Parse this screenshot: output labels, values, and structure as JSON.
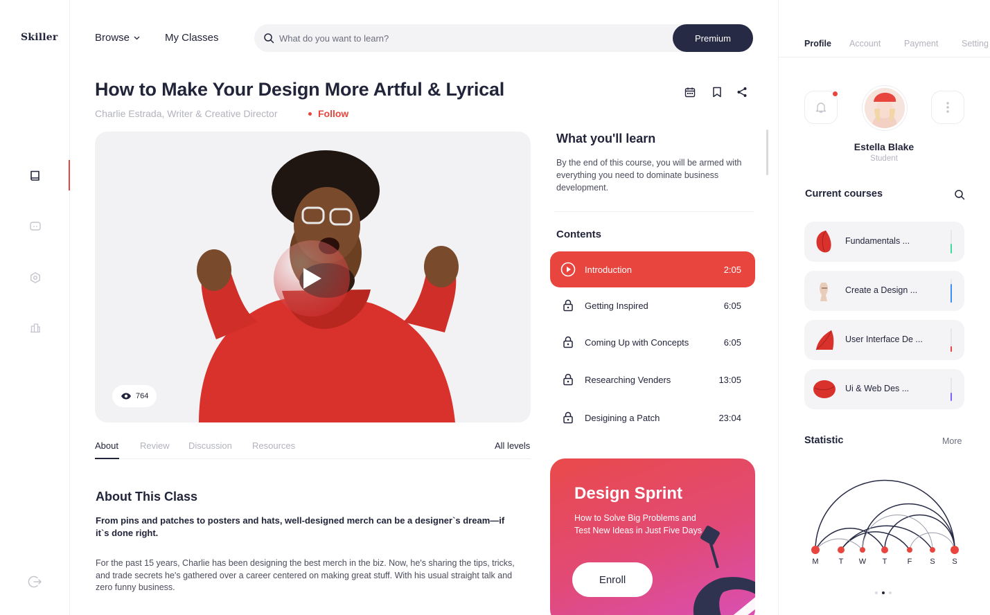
{
  "brand": {
    "logo": "Skiller"
  },
  "header": {
    "browse_label": "Browse",
    "my_classes_label": "My Classes",
    "search_placeholder": "What do you want to learn?",
    "premium_label": "Premium"
  },
  "rail": {
    "items": [
      "book-icon",
      "chat-icon",
      "settings-icon",
      "stats-icon"
    ],
    "active": "book-icon",
    "bottom": "logout-icon"
  },
  "course": {
    "title": "How to Make Your Design More Artful & Lyrical",
    "author": "Charlie Estrada, Writer & Creative Director",
    "follow_label": "Follow",
    "views": "764"
  },
  "tabs": {
    "items": [
      "About",
      "Review",
      "Discussion",
      "Resources"
    ],
    "active": "About",
    "level": "All levels"
  },
  "about": {
    "title": "About This Class",
    "lead": "From pins and patches to posters and hats, well-designed merch can be a designer`s dream—if it`s done right.",
    "body": "For the past 15 years, Charlie has been designing the best merch in the biz. Now, he's sharing the tips, tricks, and trade secrets he's gathered over a career centered on making great stuff. With his usual straight talk and zero funny business."
  },
  "learn": {
    "title": "What you'll learn",
    "description": "By the end of this course, you will be armed with everything you need to dominate business development."
  },
  "contents": {
    "title": "Contents",
    "lessons": [
      {
        "title": "Introduction",
        "time": "2:05",
        "state": "playing"
      },
      {
        "title": "Getting Inspired",
        "time": "6:05",
        "state": "locked"
      },
      {
        "title": "Coming Up with Concepts",
        "time": "6:05",
        "state": "locked"
      },
      {
        "title": "Researching Venders",
        "time": "13:05",
        "state": "locked"
      },
      {
        "title": "Desigining a Patch",
        "time": "23:04",
        "state": "locked"
      }
    ]
  },
  "promo": {
    "title": "Design Sprint",
    "description": "How to Solve Big Problems and Test New Ideas in Just Five Days",
    "enroll_label": "Enroll"
  },
  "profile": {
    "tabs": [
      "Profile",
      "Account",
      "Payment",
      "Setting"
    ],
    "active_tab": "Profile",
    "name": "Estella Blake",
    "role": "Student"
  },
  "current_courses": {
    "title": "Current courses",
    "items": [
      {
        "label": "Fundamentals ...",
        "progress": 0.4,
        "color": "#3ddc97"
      },
      {
        "label": "Create a Design ...",
        "progress": 0.8,
        "color": "#3a8ef6"
      },
      {
        "label": "User Interface De ...",
        "progress": 0.25,
        "color": "#e8453e"
      },
      {
        "label": "Ui & Web Des ...",
        "progress": 0.35,
        "color": "#7b61ff"
      }
    ]
  },
  "statistic": {
    "title": "Statistic",
    "more_label": "More",
    "days": [
      "M",
      "T",
      "W",
      "T",
      "F",
      "S",
      "S"
    ]
  },
  "colors": {
    "accent": "#e8453e",
    "navy": "#262a44",
    "text": "#22243a",
    "muted": "#b2b3bc"
  }
}
